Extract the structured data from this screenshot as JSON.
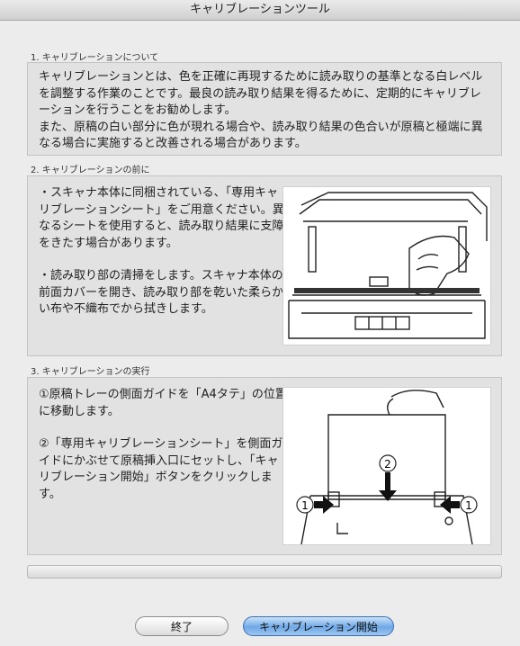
{
  "window": {
    "title": "キャリブレーションツール"
  },
  "sections": [
    {
      "title": "1. キャリブレーションについて",
      "paragraphs": [
        "キャリブレーションとは、色を正確に再現するために読み取りの基準となる白レベルを調整する作業のことです。最良の読み取り結果を得るために、定期的にキャリブレーションを行うことをお勧めします。",
        "また、原稿の白い部分に色が現れる場合や、読み取り結果の色合いが原稿と極端に異なる場合に実施すると改善される場合があります。"
      ]
    },
    {
      "title": "2. キャリブレーションの前に",
      "paragraphs": [
        "・スキャナ本体に同梱されている、「専用キャリブレーションシート」をご用意ください。異なるシートを使用すると、読み取り結果に支障をきたす場合があります。",
        "・読み取り部の清掃をします。スキャナ本体の前面カバーを開き、読み取り部を乾いた柔らかい布や不織布でから拭きします。"
      ]
    },
    {
      "title": "3. キャリブレーションの実行",
      "paragraphs": [
        "①原稿トレーの側面ガイドを「A4タテ」の位置に移動します。",
        "②「専用キャリブレーションシート」を側面ガイドにかぶせて原稿挿入口にセットし、「キャリブレーション開始」ボタンをクリックします。"
      ]
    }
  ],
  "illustration_labels": {
    "left": "1",
    "center": "2",
    "right": "1"
  },
  "progress": 0,
  "buttons": {
    "close": "終了",
    "start": "キャリブレーション開始"
  }
}
